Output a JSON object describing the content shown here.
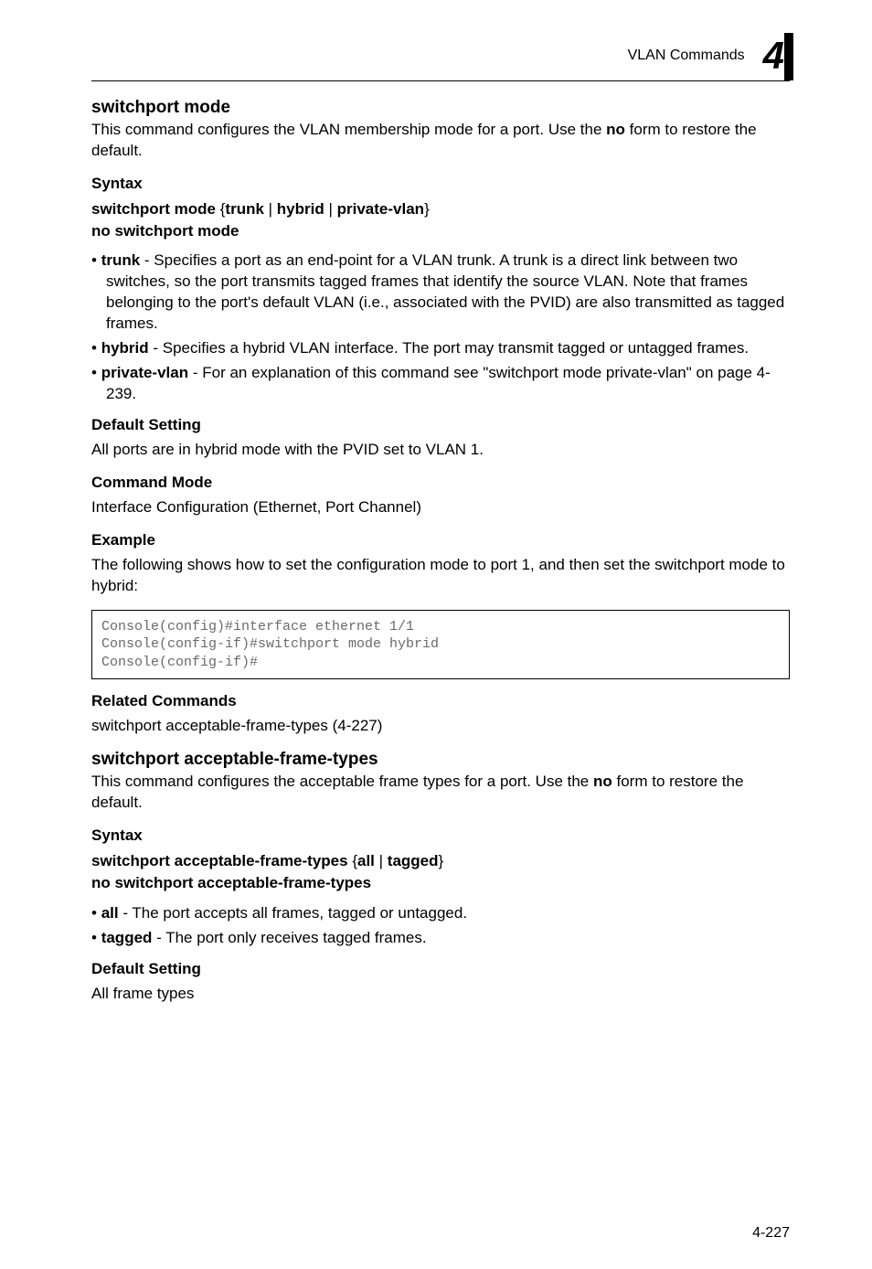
{
  "runningHead": "VLAN Commands",
  "chapterNumber": "4",
  "section1": {
    "title": "switchport mode",
    "intro_pre": "This command configures the VLAN membership mode for a port. Use the ",
    "intro_bold": "no",
    "intro_post": " form to restore the default.",
    "syntax_heading": "Syntax",
    "syntax_line1_pre": "switchport mode",
    "syntax_line1_body": " {",
    "syntax_opt1": "trunk",
    "syntax_sep": " | ",
    "syntax_opt2": "hybrid",
    "syntax_opt3": "private-vlan",
    "syntax_line1_end": "}",
    "syntax_line2": "no switchport mode",
    "bullets": [
      {
        "term": "trunk",
        "desc": " - Specifies a port as an end-point for a VLAN trunk. A trunk is a direct link between two switches, so the port transmits tagged frames that identify the source VLAN. Note that frames belonging to the port's default VLAN (i.e., associated with the PVID) are also transmitted as tagged frames."
      },
      {
        "term": "hybrid",
        "desc": " - Specifies a hybrid VLAN interface. The port may transmit tagged or untagged frames."
      },
      {
        "term": "private-vlan",
        "desc": " - For an explanation of this command see \"switchport mode private-vlan\" on page 4-239."
      }
    ],
    "default_heading": "Default Setting",
    "default_body": "All ports are in hybrid mode with the PVID set to VLAN 1.",
    "mode_heading": "Command Mode",
    "mode_body": "Interface Configuration (Ethernet, Port Channel)",
    "example_heading": "Example",
    "example_intro": "The following shows how to set the configuration mode to port 1, and then set the switchport mode to hybrid:",
    "code": "Console(config)#interface ethernet 1/1\nConsole(config-if)#switchport mode hybrid\nConsole(config-if)#",
    "related_heading": "Related Commands",
    "related_body": "switchport acceptable-frame-types (4-227)"
  },
  "section2": {
    "title": "switchport acceptable-frame-types",
    "intro_pre": "This command configures the acceptable frame types for a port. Use the ",
    "intro_bold": "no",
    "intro_post": " form to restore the default.",
    "syntax_heading": "Syntax",
    "syntax_line1_pre": "switchport acceptable-frame-types",
    "syntax_line1_body": " {",
    "syntax_opt1": "all",
    "syntax_sep": " | ",
    "syntax_opt2": "tagged",
    "syntax_line1_end": "}",
    "syntax_line2": "no switchport acceptable-frame-types",
    "bullets": [
      {
        "term": "all",
        "desc": " - The port accepts all frames, tagged or untagged."
      },
      {
        "term": "tagged",
        "desc": " - The port only receives tagged frames."
      }
    ],
    "default_heading": "Default Setting",
    "default_body": "All frame types"
  },
  "pageNumber": "4-227"
}
